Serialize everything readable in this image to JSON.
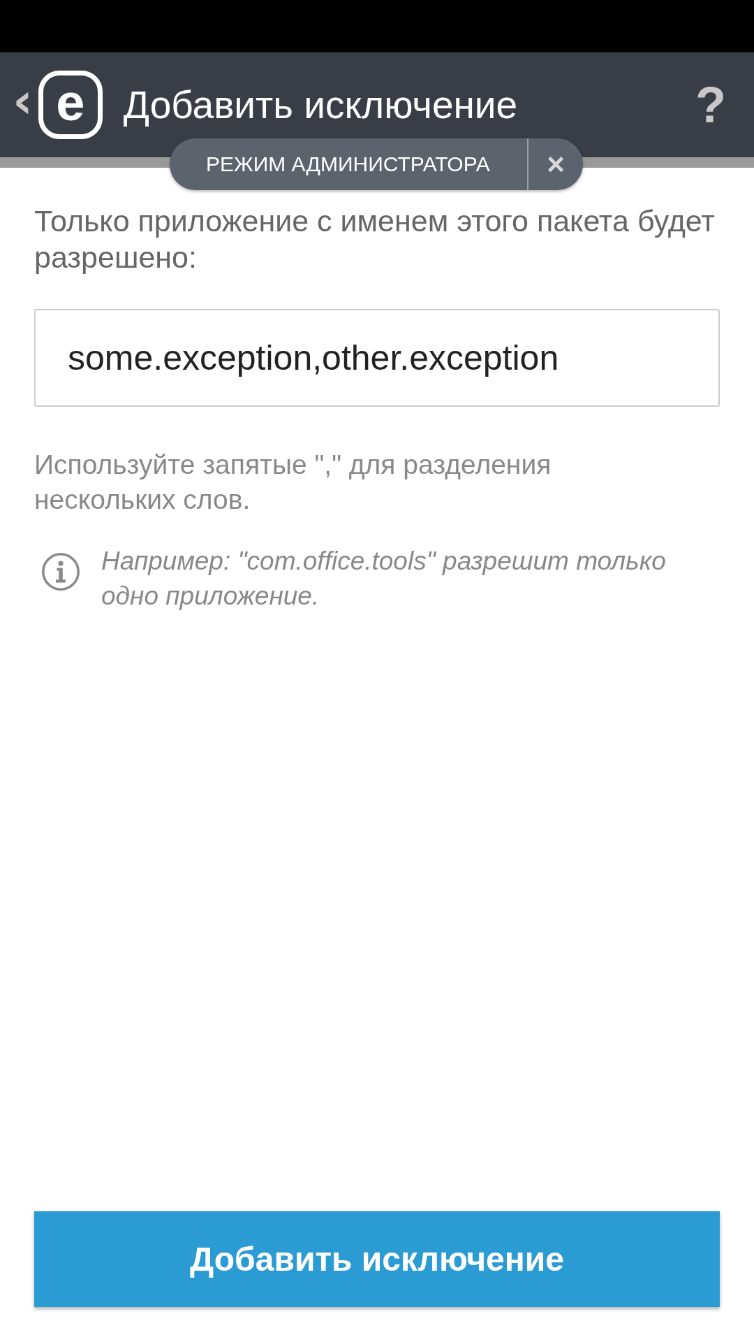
{
  "header": {
    "back": "‹",
    "logo": "e",
    "title": "Добавить исключение",
    "help": "?"
  },
  "admin_pill": {
    "label": "РЕЖИМ АДМИНИСТРАТОРА",
    "close": "×"
  },
  "description": "Только приложение с именем этого пакета будет разрешено:",
  "field": {
    "value": "some.exception,other.exception"
  },
  "hint": "Используйте запятые \",\" для разделения нескольких слов.",
  "info": "Например: \"com.office.tools\" разрешит только одно приложение.",
  "button": "Добавить исключение"
}
